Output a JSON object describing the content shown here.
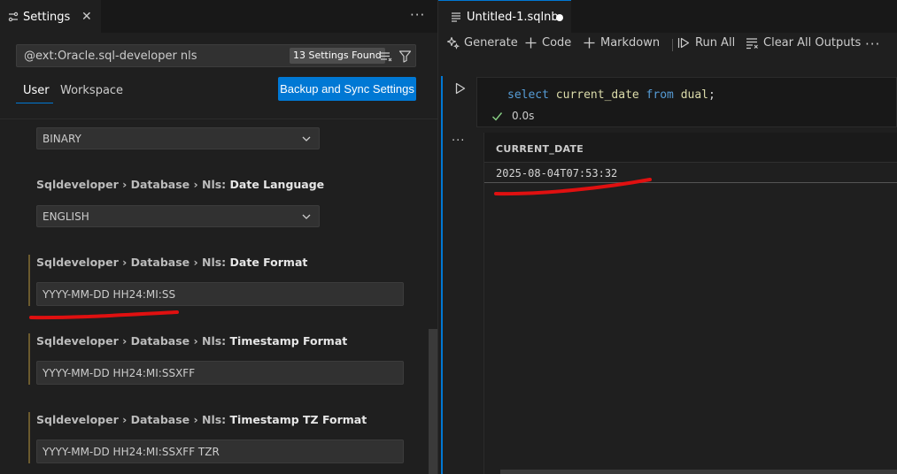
{
  "settings_editor": {
    "tab_title": "Settings",
    "search_query": "@ext:Oracle.sql-developer nls",
    "results_count": "13 Settings Found",
    "scope_tabs": [
      "User",
      "Workspace"
    ],
    "sync_button": "Backup and Sync Settings",
    "settings": [
      {
        "dropdown_value": "BINARY"
      },
      {
        "category": "Sqldeveloper › Database › Nls: ",
        "name": "Date Language",
        "dropdown_value": "ENGLISH"
      },
      {
        "category": "Sqldeveloper › Database › Nls: ",
        "name": "Date Format",
        "value": "YYYY-MM-DD HH24:MI:SS"
      },
      {
        "category": "Sqldeveloper › Database › Nls: ",
        "name": "Timestamp Format",
        "value": "YYYY-MM-DD HH24:MI:SSXFF"
      },
      {
        "category": "Sqldeveloper › Database › Nls: ",
        "name": "Timestamp TZ Format",
        "value": "YYYY-MM-DD HH24:MI:SSXFF TZR"
      }
    ]
  },
  "notebook": {
    "tab_title": "Untitled-1.sqlnb",
    "toolbar": {
      "generate": "Generate",
      "code": "Code",
      "markdown": "Markdown",
      "run_all": "Run All",
      "clear_all_outputs": "Clear All Outputs"
    },
    "cell": {
      "code_tokens": [
        "select",
        " ",
        "current_date",
        " ",
        "from",
        " ",
        "dual",
        ";"
      ],
      "exec_time": "0.0s"
    },
    "output": {
      "column_header": "CURRENT_DATE",
      "rows": [
        "2025-08-04T07:53:32"
      ]
    }
  },
  "colors": {
    "accent": "#0078d4",
    "annotation_red": "#e01010",
    "success_green": "#89d185",
    "modified_bar": "#6b5a2e"
  }
}
